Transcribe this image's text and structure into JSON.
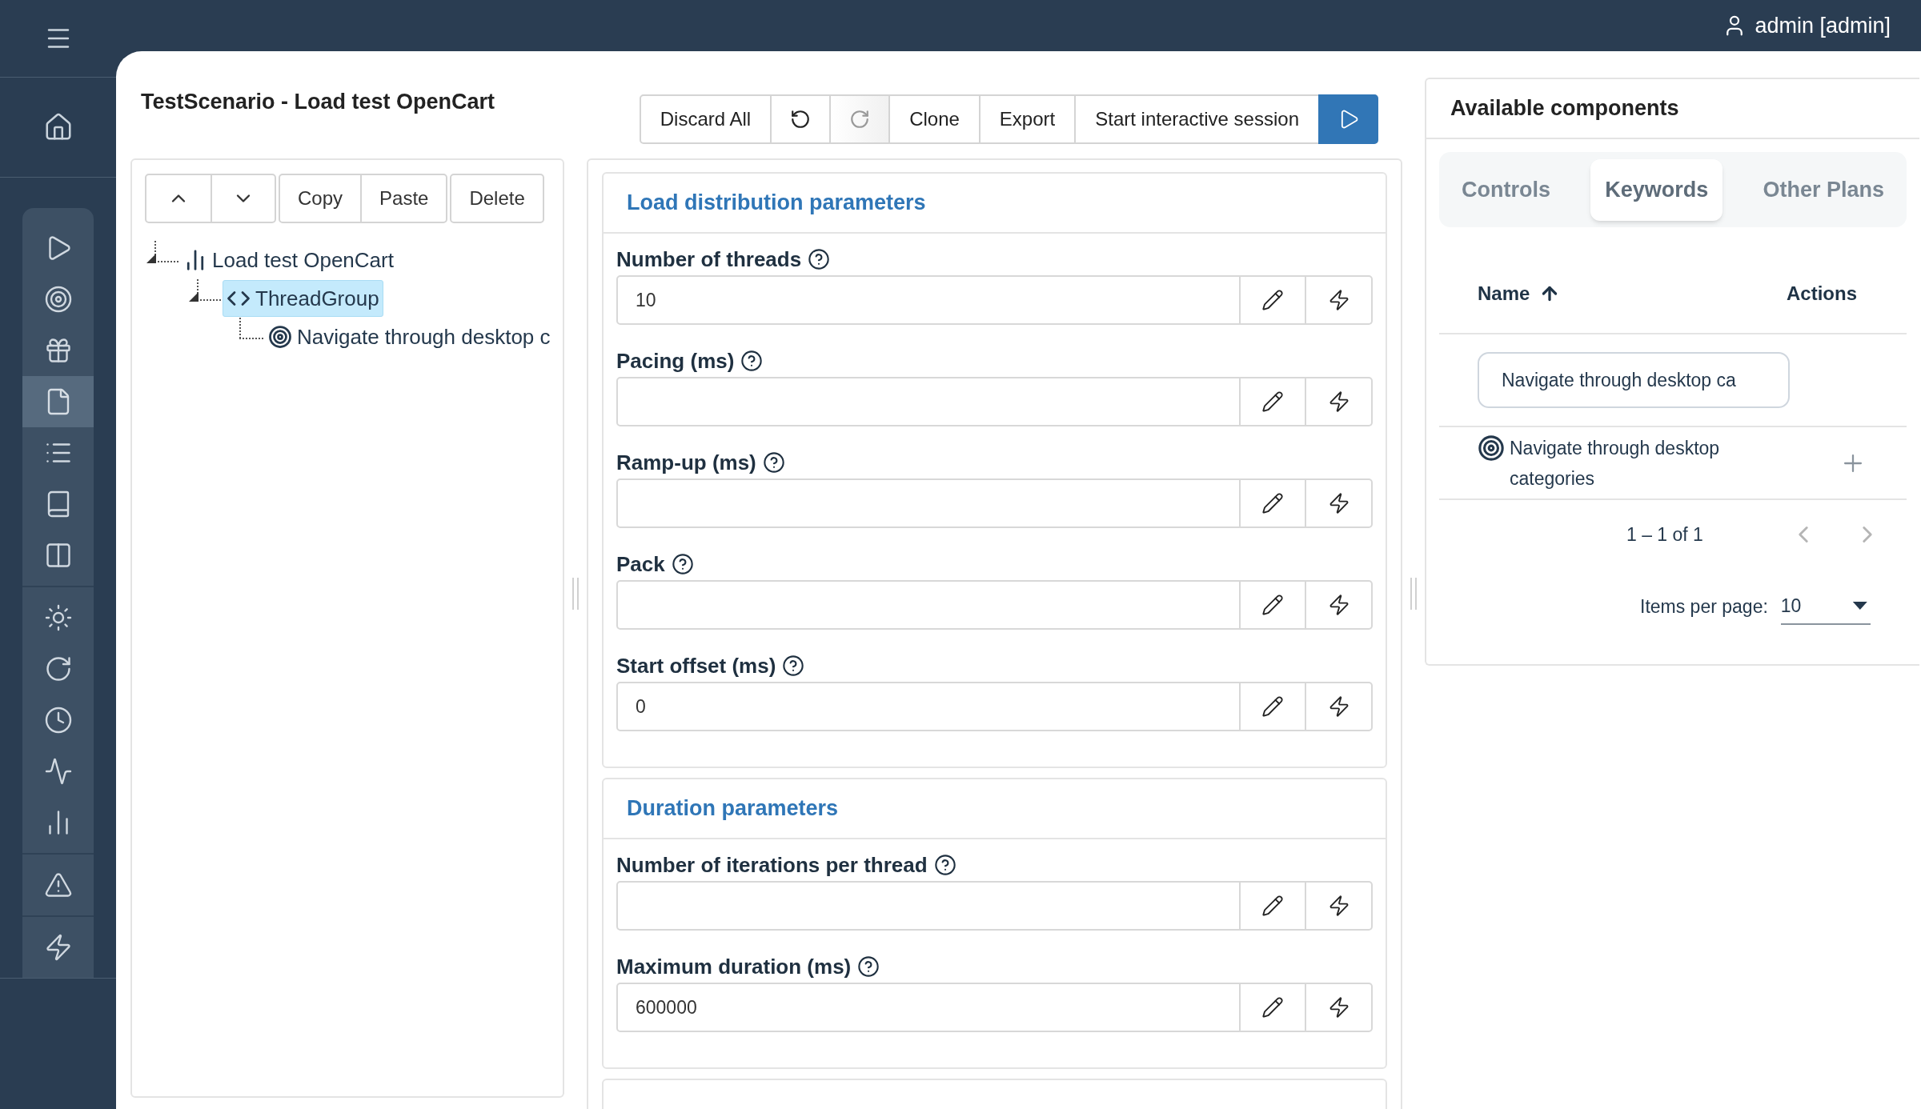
{
  "topbar": {
    "user": "admin [admin]"
  },
  "sidebar": {
    "groups": [
      {
        "items": [
          {
            "selected": false
          },
          {
            "selected": false
          },
          {
            "selected": false
          },
          {
            "selected": true
          },
          {
            "selected": false
          },
          {
            "selected": false
          },
          {
            "selected": false
          }
        ]
      },
      {
        "items": [
          {
            "selected": false
          },
          {
            "selected": false
          },
          {
            "selected": false
          },
          {
            "selected": false
          },
          {
            "selected": false
          }
        ]
      },
      {
        "items": [
          {
            "selected": false
          }
        ]
      },
      {
        "items": [
          {
            "selected": false
          }
        ]
      }
    ]
  },
  "title": "TestScenario - Load test OpenCart",
  "tree_toolbar": {
    "groups": [
      [
        {
          "kind": "up"
        },
        {
          "kind": "down"
        }
      ],
      [
        {
          "kind": "text",
          "label": "Copy"
        },
        {
          "kind": "text",
          "label": "Paste"
        }
      ],
      [
        {
          "kind": "text",
          "label": "Delete"
        }
      ]
    ]
  },
  "tree": {
    "nodes": [
      {
        "kind": "plan",
        "label": "Load test OpenCart",
        "expanded": true,
        "selected": false,
        "children": [
          {
            "kind": "thread_group",
            "label": "ThreadGroup",
            "expanded": true,
            "selected": true,
            "children": [
              {
                "kind": "keyword",
                "label": "Navigate through desktop c",
                "selected": false
              }
            ]
          }
        ]
      }
    ]
  },
  "toolbar": [
    {
      "kind": "text",
      "label": "Discard All"
    },
    {
      "kind": "undo",
      "disabled": false
    },
    {
      "kind": "redo",
      "disabled": true
    },
    {
      "kind": "text",
      "label": "Clone"
    },
    {
      "kind": "text",
      "label": "Export"
    },
    {
      "kind": "text",
      "label": "Start interactive session"
    },
    {
      "kind": "run"
    }
  ],
  "sections": [
    {
      "title": "Load distribution parameters",
      "fields": [
        {
          "label": "Number of threads",
          "value": "10"
        },
        {
          "label": "Pacing (ms)"
        },
        {
          "label": "Ramp-up (ms)"
        },
        {
          "label": "Pack"
        },
        {
          "label": "Start offset (ms)",
          "value": "0"
        }
      ]
    },
    {
      "title": "Duration parameters",
      "fields": [
        {
          "label": "Number of iterations per thread"
        },
        {
          "label": "Maximum duration (ms)",
          "value": "600000"
        }
      ]
    }
  ],
  "components": {
    "title": "Available components",
    "tabs": [
      {
        "label": "Controls",
        "selected": false
      },
      {
        "label": "Keywords",
        "selected": true
      },
      {
        "label": "Other Plans",
        "selected": false
      }
    ],
    "columns": [
      {
        "label": "Name",
        "sorted_ascending": true
      },
      {
        "label": "Actions"
      }
    ],
    "filter": {
      "value": "Navigate through desktop ca"
    },
    "rows": [
      {
        "name": "Navigate through desktop categories"
      }
    ],
    "pagination": {
      "range": "1 – 1 of 1",
      "prev_disabled": true,
      "next_disabled": true,
      "items_per_page_label": "Items per page:",
      "items_per_page": "10"
    }
  }
}
